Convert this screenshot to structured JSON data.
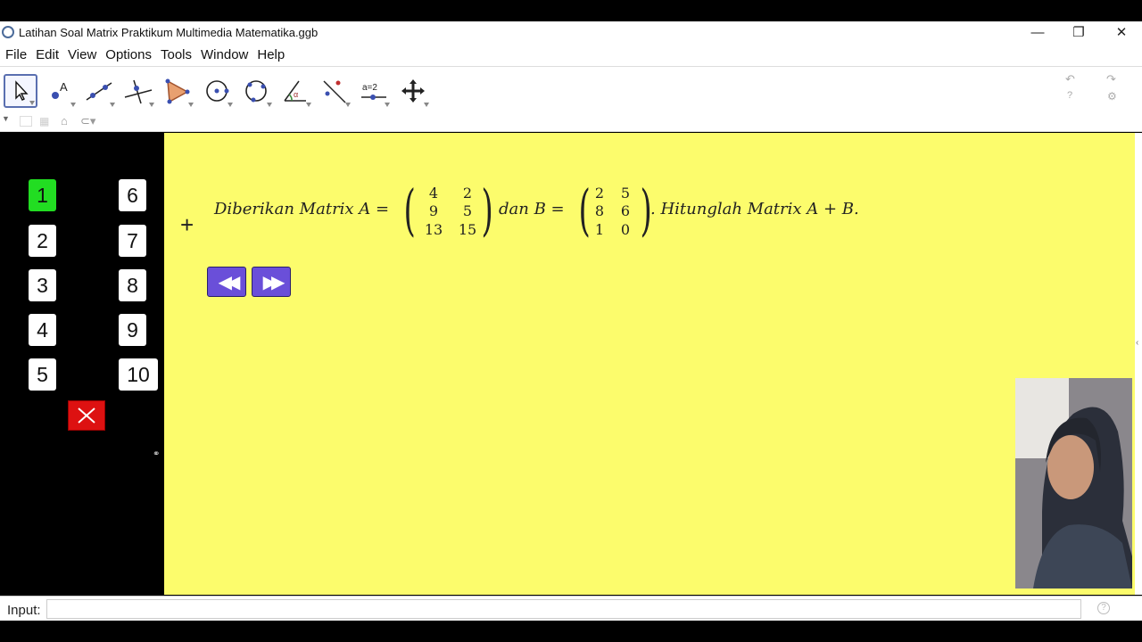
{
  "window": {
    "title": "Latihan Soal Matrix Praktikum Multimedia Matematika.ggb",
    "minimize": "—",
    "restore": "❐",
    "close": "✕"
  },
  "menu": [
    "File",
    "Edit",
    "View",
    "Options",
    "Tools",
    "Window",
    "Help"
  ],
  "toolbar": {
    "tools": [
      "move-tool",
      "point-tool",
      "line-tool",
      "perpendicular-tool",
      "polygon-tool",
      "circle-tool",
      "circle-3pt-tool",
      "angle-tool",
      "reflect-tool",
      "slider-tool",
      "move-view-tool"
    ],
    "slider_label": "a=2",
    "undo": "↶",
    "redo": "↷"
  },
  "leftpanel": {
    "buttons": [
      "1",
      "2",
      "3",
      "4",
      "5",
      "6",
      "7",
      "8",
      "9",
      "10"
    ],
    "selected": "1",
    "selected_color": "#22dd22",
    "close_color": "#dd1111"
  },
  "problem": {
    "intro": "Diberikan Matrix A =",
    "matrix_a": [
      [
        "4",
        "2"
      ],
      [
        "9",
        "5"
      ],
      [
        "13",
        "15"
      ]
    ],
    "middle": "dan B =",
    "matrix_b": [
      [
        "2",
        "5"
      ],
      [
        "8",
        "6"
      ],
      [
        "1",
        "0"
      ]
    ],
    "outro": ". Hitunglah Matrix A + B."
  },
  "nav": {
    "prev": "◀◀",
    "next": "▶▶",
    "color": "#6a4fd9"
  },
  "background_color": "#fcfc6c",
  "input": {
    "label": "Input:",
    "value": ""
  }
}
